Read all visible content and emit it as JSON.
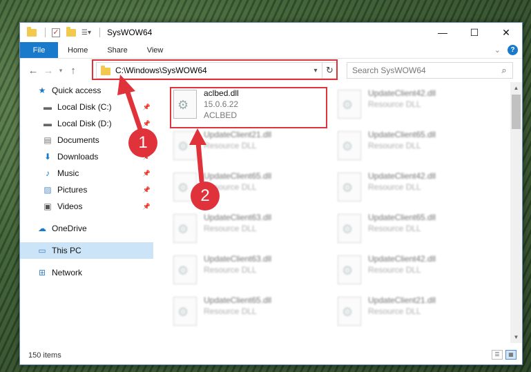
{
  "window": {
    "title": "SysWOW64",
    "controls": {
      "minimize": "—",
      "maximize": "☐",
      "close": "✕"
    }
  },
  "ribbon": {
    "file": "File",
    "home": "Home",
    "share": "Share",
    "view": "View"
  },
  "address": {
    "path": "C:\\Windows\\SysWOW64",
    "search_placeholder": "Search SysWOW64"
  },
  "sidebar": {
    "quick_access": "Quick access",
    "items": [
      {
        "label": "Local Disk (C:)",
        "icon": "drive-icon"
      },
      {
        "label": "Local Disk (D:)",
        "icon": "drive-icon"
      },
      {
        "label": "Documents",
        "icon": "documents-icon"
      },
      {
        "label": "Downloads",
        "icon": "downloads-icon"
      },
      {
        "label": "Music",
        "icon": "music-icon"
      },
      {
        "label": "Pictures",
        "icon": "pictures-icon"
      },
      {
        "label": "Videos",
        "icon": "videos-icon"
      }
    ],
    "onedrive": "OneDrive",
    "this_pc": "This PC",
    "network": "Network"
  },
  "files": [
    {
      "name": "aclbed.dll",
      "line2": "15.0.6.22",
      "line3": "ACLBED"
    },
    {
      "name": "UpdateClient42.dll",
      "line2": "Resource DLL"
    },
    {
      "name": "UpdateClient21.dll",
      "line2": "Resource DLL"
    },
    {
      "name": "UpdateClient65.dll",
      "line2": "Resource DLL"
    },
    {
      "name": "UpdateClient65.dll",
      "line2": "Resource DLL"
    },
    {
      "name": "UpdateClient42.dll",
      "line2": "Resource DLL"
    },
    {
      "name": "UpdateClient63.dll",
      "line2": "Resource DLL"
    },
    {
      "name": "UpdateClient65.dll",
      "line2": "Resource DLL"
    },
    {
      "name": "UpdateClient63.dll",
      "line2": "Resource DLL"
    },
    {
      "name": "UpdateClient42.dll",
      "line2": "Resource DLL"
    },
    {
      "name": "UpdateClient65.dll",
      "line2": "Resource DLL"
    },
    {
      "name": "UpdateClient21.dll",
      "line2": "Resource DLL"
    }
  ],
  "status": {
    "count": "150 items"
  },
  "annotations": {
    "badge1": "1",
    "badge2": "2",
    "color": "#e0323a"
  }
}
